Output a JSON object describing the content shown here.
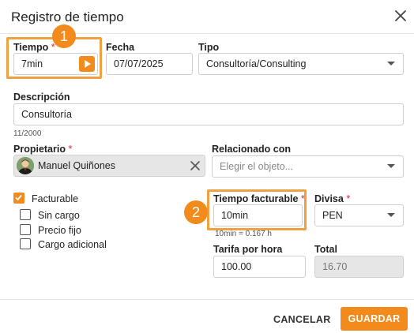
{
  "dialog": {
    "title": "Registro de tiempo",
    "fields": {
      "tiempo": {
        "label": "Tiempo",
        "required": "*",
        "value": "7min"
      },
      "fecha": {
        "label": "Fecha",
        "value": "07/07/2025"
      },
      "tipo": {
        "label": "Tipo",
        "value": "Consultoría/Consulting"
      },
      "descripcion": {
        "label": "Descripción",
        "value": "Consultoría",
        "counter": "11/2000"
      },
      "propietario": {
        "label": "Propietario",
        "required": "*",
        "value": "Manuel Quiñones"
      },
      "relacionado": {
        "label": "Relacionado con",
        "placeholder": "Elegir el objeto..."
      },
      "facturable": {
        "label": "Facturable",
        "checked": true
      },
      "sin_cargo": {
        "label": "Sin cargo",
        "checked": false
      },
      "precio_fijo": {
        "label": "Precio fijo",
        "checked": false
      },
      "cargo_adicional": {
        "label": "Cargo adicional",
        "checked": false
      },
      "tiempo_facturable": {
        "label": "Tiempo facturable",
        "required": "*",
        "value": "10min",
        "hint": "10min = 0.167 h"
      },
      "divisa": {
        "label": "Divisa",
        "required": "*",
        "value": "PEN"
      },
      "tarifa": {
        "label": "Tarifa por hora",
        "value": "100.00"
      },
      "total": {
        "label": "Total",
        "value": "16.70"
      }
    },
    "callouts": [
      "1",
      "2"
    ],
    "buttons": {
      "cancel": "CANCELAR",
      "save": "GUARDAR"
    }
  },
  "colors": {
    "accent": "#f28a1c",
    "highlight_border": "#f0a040",
    "required": "#e0242e"
  }
}
